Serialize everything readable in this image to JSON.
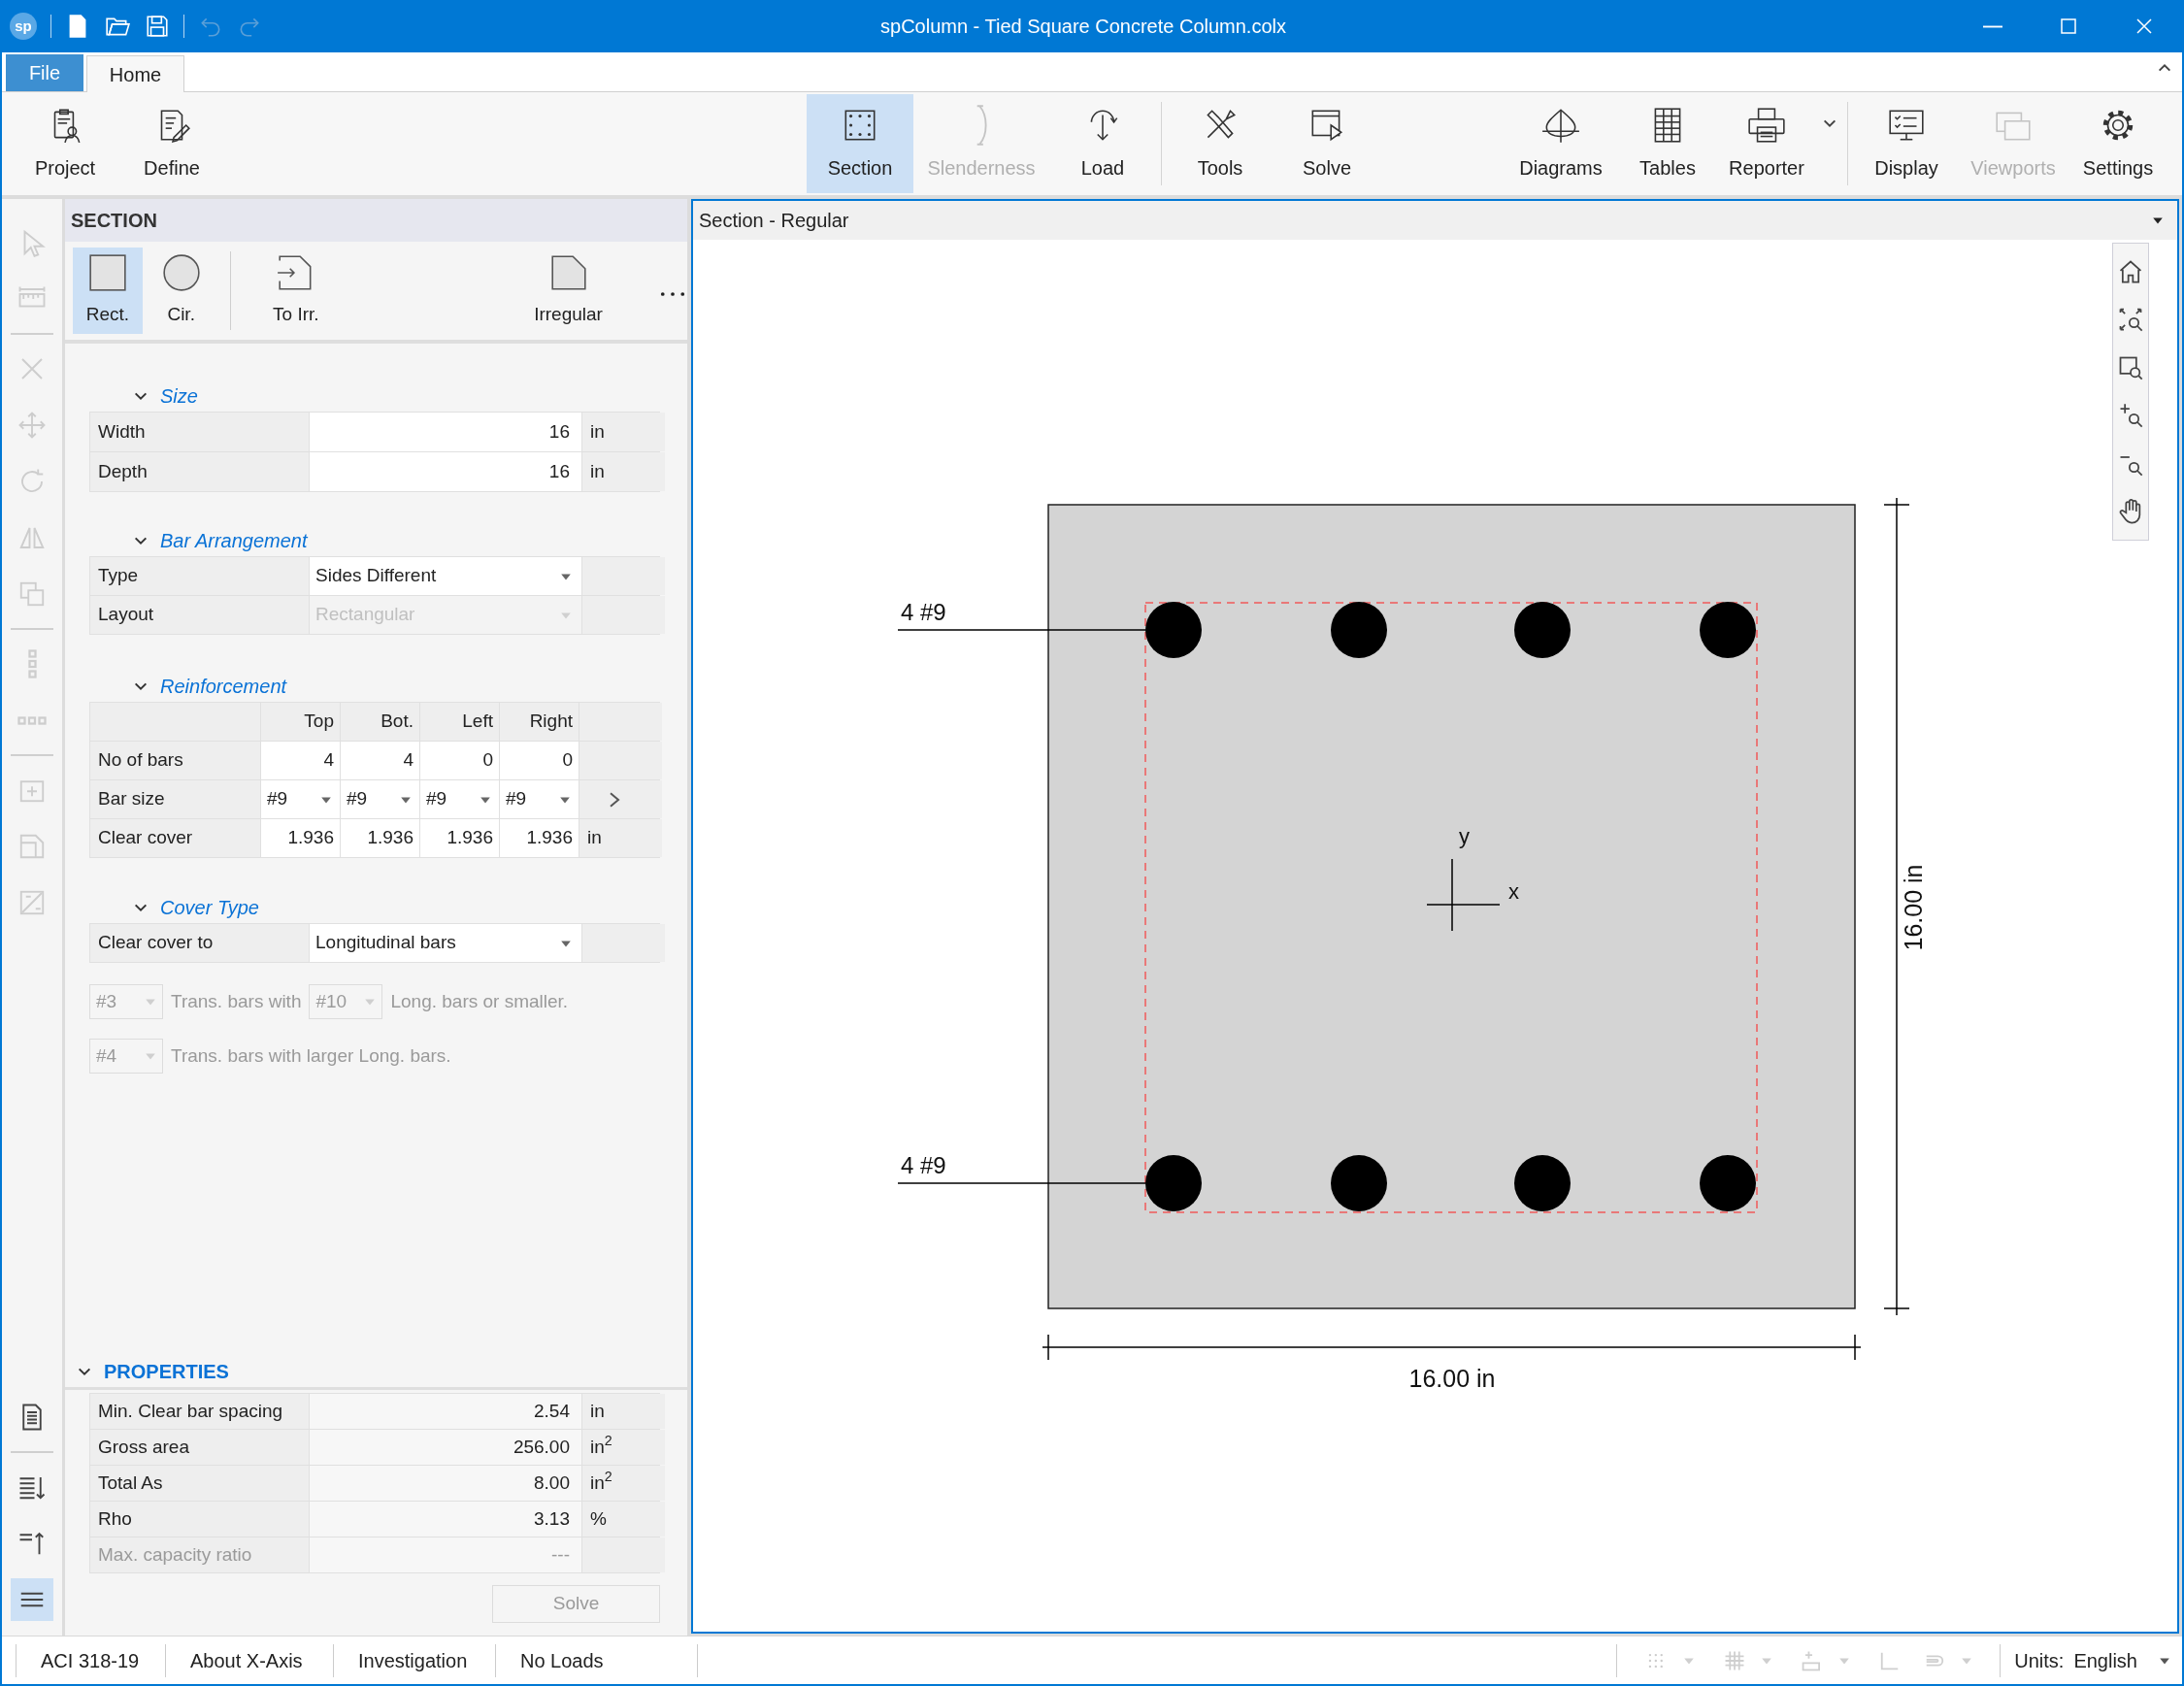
{
  "title_bar": {
    "logo": "sp",
    "title": "spColumn - Tied Square Concrete Column.colx"
  },
  "ribbon_tabs": [
    {
      "label": "File",
      "kind": "file",
      "selected": false
    },
    {
      "label": "Home",
      "kind": "tab",
      "selected": true
    }
  ],
  "ribbon_groups": [
    {
      "items": [
        {
          "label": "Project",
          "kind": "button",
          "selected": false,
          "disabled": false
        },
        {
          "label": "Define",
          "kind": "button",
          "selected": false,
          "disabled": false
        }
      ]
    },
    {
      "items": [
        {
          "label": "Section",
          "kind": "button",
          "selected": true,
          "disabled": false
        },
        {
          "label": "Slenderness",
          "kind": "button",
          "selected": false,
          "disabled": true
        },
        {
          "label": "Load",
          "kind": "button",
          "selected": false,
          "disabled": false
        }
      ]
    },
    {
      "items": [
        {
          "label": "Tools",
          "kind": "button",
          "selected": false,
          "disabled": false
        },
        {
          "label": "Solve",
          "kind": "button",
          "selected": false,
          "disabled": false
        }
      ]
    },
    {
      "items": [
        {
          "label": "Diagrams",
          "kind": "button",
          "selected": false,
          "disabled": false
        },
        {
          "label": "Tables",
          "kind": "button",
          "selected": false,
          "disabled": false
        },
        {
          "label": "Reporter",
          "kind": "split",
          "selected": false,
          "disabled": false
        }
      ]
    },
    {
      "items": [
        {
          "label": "Display",
          "kind": "button",
          "selected": false,
          "disabled": false
        },
        {
          "label": "Viewports",
          "kind": "button",
          "selected": false,
          "disabled": true
        },
        {
          "label": "Settings",
          "kind": "button",
          "selected": false,
          "disabled": false
        }
      ]
    }
  ],
  "left_toolbar": {
    "top_items": [
      {
        "kind": "button",
        "disabled": true,
        "selected": false
      },
      {
        "kind": "button",
        "disabled": true,
        "selected": false
      },
      {
        "kind": "separator"
      },
      {
        "kind": "button",
        "disabled": true,
        "selected": false
      },
      {
        "kind": "button",
        "disabled": true,
        "selected": false
      },
      {
        "kind": "button",
        "disabled": true,
        "selected": false
      },
      {
        "kind": "button",
        "disabled": true,
        "selected": false
      },
      {
        "kind": "button",
        "disabled": true,
        "selected": false
      },
      {
        "kind": "separator"
      },
      {
        "kind": "button",
        "disabled": true,
        "selected": false
      },
      {
        "kind": "button",
        "disabled": true,
        "selected": false
      },
      {
        "kind": "separator"
      },
      {
        "kind": "button",
        "disabled": true,
        "selected": false
      },
      {
        "kind": "button",
        "disabled": true,
        "selected": false
      },
      {
        "kind": "button",
        "disabled": true,
        "selected": false
      }
    ],
    "bottom_items": [
      {
        "kind": "button",
        "disabled": false,
        "selected": false
      },
      {
        "kind": "separator"
      },
      {
        "kind": "button",
        "disabled": false,
        "selected": false
      },
      {
        "kind": "button",
        "disabled": false,
        "selected": false
      },
      {
        "kind": "button",
        "disabled": false,
        "selected": true
      }
    ]
  },
  "section_panel": {
    "title": "SECTION",
    "shape_groups": [
      {
        "items": [
          {
            "label": "Rect.",
            "selected": true
          },
          {
            "label": "Cir.",
            "selected": false
          }
        ]
      },
      {
        "items": [
          {
            "label": "To Irr.",
            "selected": false
          },
          {
            "label": "Irregular",
            "selected": false
          }
        ]
      }
    ],
    "size": {
      "title": "Size",
      "expanded": true,
      "rows": [
        {
          "label": "Width",
          "value": "16",
          "unit": "in"
        },
        {
          "label": "Depth",
          "value": "16",
          "unit": "in"
        }
      ]
    },
    "bar_arrangement": {
      "title": "Bar Arrangement",
      "expanded": true,
      "rows": [
        {
          "label": "Type",
          "value": "Sides Different",
          "disabled": false
        },
        {
          "label": "Layout",
          "value": "Rectangular",
          "disabled": true
        }
      ]
    },
    "reinforcement": {
      "title": "Reinforcement",
      "expanded": true,
      "columns": [
        "Top",
        "Bot.",
        "Left",
        "Right"
      ],
      "rows": [
        {
          "label": "No of bars",
          "kind": "number",
          "cells": [
            "4",
            "4",
            "0",
            "0"
          ]
        },
        {
          "label": "Bar size",
          "kind": "dropdown",
          "cells": [
            "#9",
            "#9",
            "#9",
            "#9"
          ]
        },
        {
          "label": "Clear cover",
          "kind": "number",
          "cells": [
            "1.936",
            "1.936",
            "1.936",
            "1.936"
          ],
          "unit": "in"
        }
      ]
    },
    "cover_type": {
      "title": "Cover Type",
      "expanded": true,
      "rows": [
        {
          "label": "Clear cover to",
          "value": "Longitudinal bars",
          "disabled": false
        }
      ],
      "rules": [
        {
          "disabled": true,
          "parts": [
            {
              "kind": "dropdown",
              "text": "#3"
            },
            {
              "kind": "text",
              "text": "Trans. bars with"
            },
            {
              "kind": "dropdown",
              "text": "#10"
            },
            {
              "kind": "text",
              "text": "Long. bars or smaller."
            }
          ]
        },
        {
          "disabled": true,
          "parts": [
            {
              "kind": "dropdown",
              "text": "#4"
            },
            {
              "kind": "text",
              "text": "Trans. bars with larger Long. bars."
            }
          ]
        }
      ]
    }
  },
  "properties": {
    "title": "PROPERTIES",
    "expanded": true,
    "rows": [
      {
        "label": "Min. Clear bar spacing",
        "value": "2.54",
        "unit": "in",
        "disabled": false
      },
      {
        "label": "Gross area",
        "value": "256.00",
        "unit": "in$^{2}$",
        "disabled": false
      },
      {
        "label": "Total As",
        "value": "8.00",
        "unit": "in$^{2}$",
        "disabled": false
      },
      {
        "label": "Rho",
        "value": "3.13",
        "unit": "%",
        "disabled": false
      },
      {
        "label": "Max. capacity ratio",
        "value": "---",
        "disabled": true
      }
    ],
    "button": {
      "label": "Solve",
      "disabled": true
    }
  },
  "canvas": {
    "title": "Section - Regular",
    "top_bars_label": "4 #9",
    "bottom_bars_label": "4 #9",
    "y_axis_label": "y",
    "x_axis_label": "x",
    "width_label": "16.00 in",
    "depth_label": "16.00 in"
  },
  "status_bar": {
    "items": [
      "ACI 318-19",
      "About X-Axis",
      "Investigation",
      "No Loads"
    ],
    "units_label": "Units:",
    "units_value": "English"
  }
}
